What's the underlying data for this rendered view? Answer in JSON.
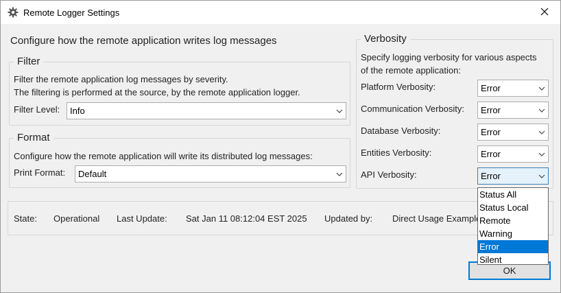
{
  "window": {
    "title": "Remote Logger Settings",
    "close_glyph": "✕"
  },
  "main": {
    "heading": "Configure how the remote application writes log messages"
  },
  "filter": {
    "group_label": "Filter",
    "description_line1": "Filter the remote application log messages by severity.",
    "description_line2": "The filtering is performed at the source, by the remote application logger.",
    "level_label": "Filter Level:",
    "level_value": "Info"
  },
  "format": {
    "group_label": "Format",
    "description": "Configure how the remote application will write its distributed log messages:",
    "print_label": "Print Format:",
    "print_value": "Default"
  },
  "verbosity": {
    "group_label": "Verbosity",
    "description_line1": "Specify logging verbosity for various aspects",
    "description_line2": "of the remote application:",
    "rows": [
      {
        "label": "Platform Verbosity:",
        "value": "Error"
      },
      {
        "label": "Communication Verbosity:",
        "value": "Error"
      },
      {
        "label": "Database Verbosity:",
        "value": "Error"
      },
      {
        "label": "Entities Verbosity:",
        "value": "Error"
      },
      {
        "label": "API Verbosity:",
        "value": "Error"
      }
    ],
    "dropdown_options": [
      "Status All",
      "Status Local",
      "Remote",
      "Warning",
      "Error",
      "Silent"
    ],
    "selected_option": "Error"
  },
  "status": {
    "state_label": "State:",
    "state_value": "Operational",
    "update_label": "Last Update:",
    "update_value": "Sat Jan 11 08:12:04 EST 2025",
    "updated_by_label": "Updated by:",
    "updated_by_value": "Direct Usage Example"
  },
  "buttons": {
    "ok_label": "OK"
  },
  "colors": {
    "accent": "#0078d7",
    "selection": "#0078d7",
    "background": "#f0f0f0"
  },
  "icons": {
    "app": "gear-icon",
    "close": "close-icon",
    "dropdown": "chevron-down-icon"
  }
}
